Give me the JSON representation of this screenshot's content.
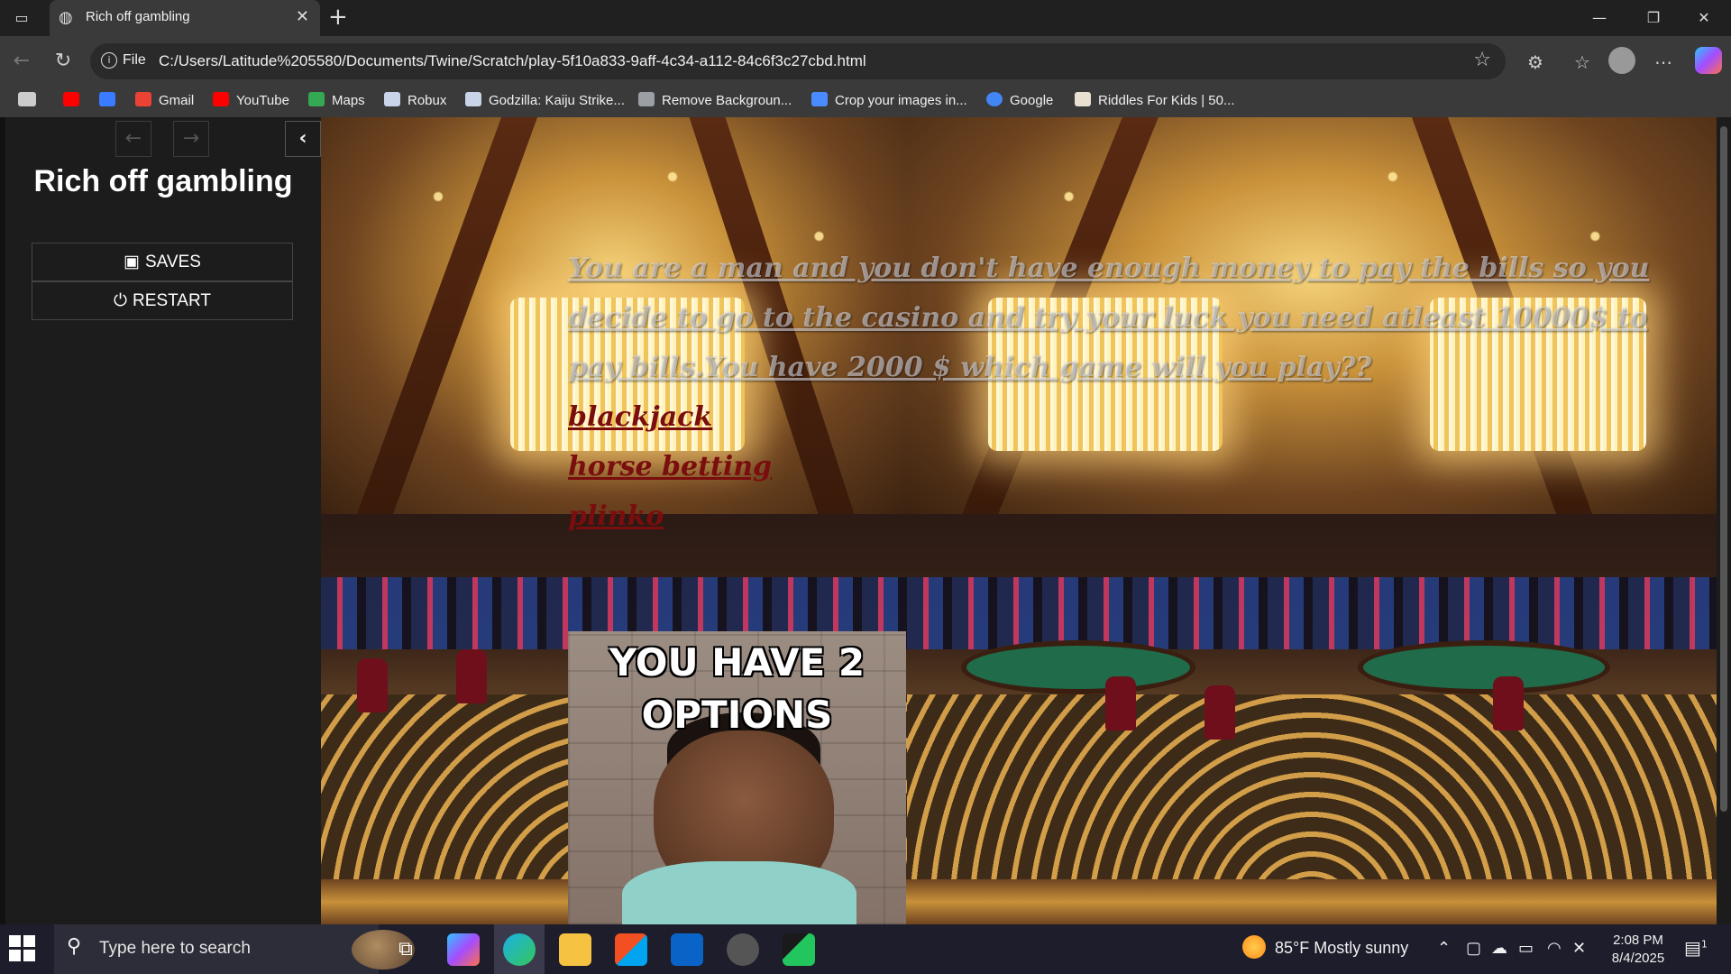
{
  "browser": {
    "tab_title": "Rich off gambling",
    "address_scheme": "File",
    "address_url": "C:/Users/Latitude%205580/Documents/Twine/Scratch/play-5f10a833-9aff-4c34-a112-84c6f3c27cbd.html"
  },
  "bookmarks": [
    {
      "label": "Gmail",
      "color": "#ea4335"
    },
    {
      "label": "YouTube",
      "color": "#ff0000"
    },
    {
      "label": "Maps",
      "color": "#34a853"
    },
    {
      "label": "Robux",
      "color": "#c9d4e8"
    },
    {
      "label": "Godzilla: Kaiju Strike...",
      "color": "#c9d4e8"
    },
    {
      "label": "Remove Backgroun...",
      "color": "#9aa0a6"
    },
    {
      "label": "Crop your images in...",
      "color": "#4a8cff"
    },
    {
      "label": "Google",
      "color": "#4285f4"
    },
    {
      "label": "Riddles For Kids | 50...",
      "color": "#e8e0d0"
    }
  ],
  "sidebar": {
    "title": "Rich off gambling",
    "saves_label": "SAVES",
    "restart_label": "RESTART"
  },
  "passage": {
    "text": "You are a man and you don't have enough money to pay the bills so you decide to go to the casino and try your luck you need atleast 10000$ to pay bills.You have 2000 $ which game will you play??",
    "links": [
      "blackjack",
      "horse betting",
      "plinko"
    ]
  },
  "meme": {
    "line1": "YOU HAVE 2",
    "line2": "OPTIONS"
  },
  "taskbar": {
    "search_placeholder": "Type here to search",
    "weather": "85°F  Mostly sunny",
    "time": "2:08 PM",
    "date": "8/4/2025",
    "notification_count": "1"
  },
  "colors": {
    "link": "#7a0d0d",
    "sidebar_bg": "#1c1c1c"
  }
}
